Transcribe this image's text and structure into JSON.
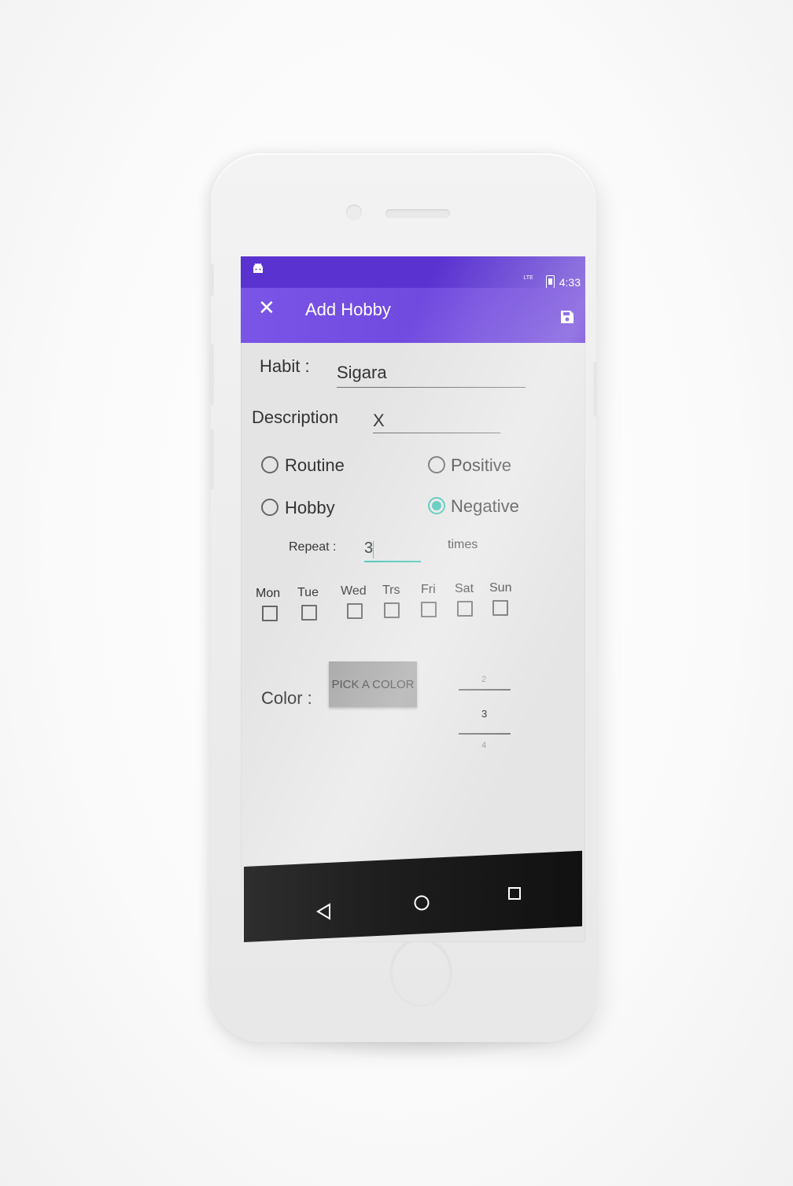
{
  "status_bar": {
    "network": "LTE",
    "time": "4:33"
  },
  "app_bar": {
    "title": "Add Hobby"
  },
  "form": {
    "habit_label": "Habit :",
    "habit_value": "Sigara",
    "description_label": "Description",
    "description_value": "X",
    "radio_options": [
      {
        "label": "Routine",
        "checked": false
      },
      {
        "label": "Positive",
        "checked": false
      },
      {
        "label": "Hobby",
        "checked": false
      },
      {
        "label": "Negative",
        "checked": true
      }
    ],
    "repeat_label": "Repeat :",
    "repeat_value": "3",
    "times_label": "times",
    "days": [
      "Mon",
      "Tue",
      "Wed",
      "Trs",
      "Fri",
      "Sat",
      "Sun"
    ],
    "color_label": "Color :",
    "pick_color_button": "PICK A COLOR",
    "number_picker": {
      "prev": "2",
      "selected": "3",
      "next": "4"
    }
  },
  "colors": {
    "primary": "#7a55e6",
    "status_bar": "#5a32d0",
    "accent": "#3fc0b0"
  },
  "icons": [
    "android-icon",
    "battery-icon",
    "close-icon",
    "save-icon",
    "back-icon",
    "home-icon",
    "recent-apps-icon"
  ]
}
